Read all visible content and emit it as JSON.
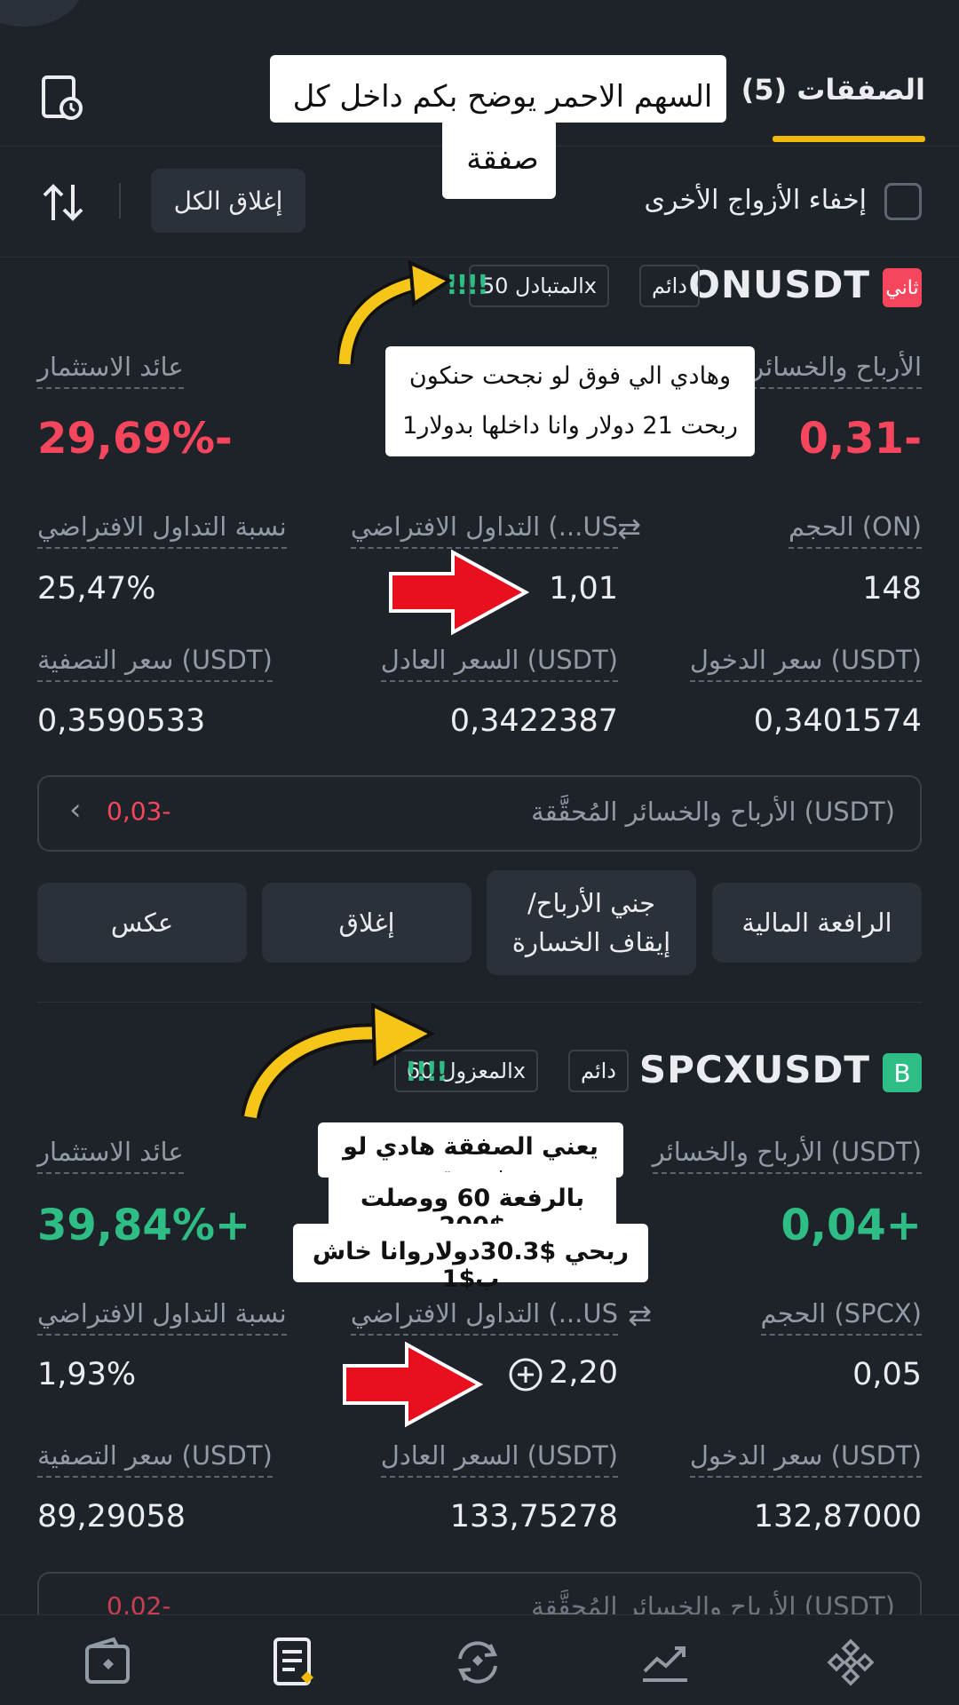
{
  "header": {
    "tab_label": "الصفقات (5)",
    "history_icon": "history-icon"
  },
  "annotation_top": "السهم الاحمر يوضح بكم داخل كل صفقة",
  "toolbar": {
    "hide_pairs_label": "إخفاء الأزواج الأخرى",
    "close_all_label": "إغلاق الكل",
    "sort_icon": "sort-arrows-icon"
  },
  "positions": [
    {
      "symbol": "ONUSDT",
      "side_badge": "ثاني",
      "type_tag": "دائم",
      "margin_tag": "المتبادل 50x",
      "bars": "!!!!",
      "note": "وهادي الي فوق لو نجحت حنكون ربحت 21 دولار وانا داخلها بدولار1",
      "pnl_label": "الأرباح والخسائر",
      "pnl_value": "0,31-",
      "roi_label": "عائد الاستثمار",
      "roi_value": "29,69%-",
      "size_label": "الحجم (ON)",
      "size_value": "148",
      "margin_label": "التداول الافتراضي (...US",
      "margin_value": "1,01",
      "margin_ratio_label": "نسبة التداول الافتراضي",
      "margin_ratio_value": "25,47%",
      "entry_label": "سعر الدخول (USDT)",
      "entry_value": "0,3401574",
      "mark_label": "السعر العادل (USDT)",
      "mark_value": "0,3422387",
      "liq_label": "سعر التصفية (USDT)",
      "liq_value": "0,3590533",
      "realized_label": "الأرباح والخسائر المُحقَّقة (USDT)",
      "realized_value": "0,03-",
      "buttons": [
        "الرافعة المالية",
        "جني الأرباح/ إيقاف الخسارة",
        "إغلاق",
        "عكس"
      ]
    },
    {
      "symbol": "SPCXUSDT",
      "side_badge": "B",
      "type_tag": "دائم",
      "margin_tag": "المعزول 60x",
      "bars": "!!!!",
      "note": [
        "يعني الصفقة هادي لو نجحت",
        "بالرفعة 60 ووصلت $200",
        "ربحي $30.3دولاروانا خاش ب$1"
      ],
      "pnl_label": "الأرباح والخسائر (USDT)",
      "pnl_value": "0,04+",
      "roi_label": "عائد الاستثمار",
      "roi_value": "39,84%+",
      "size_label": "الحجم (SPCX)",
      "size_value": "0,05",
      "margin_label": "التداول الافتراضي (...US",
      "margin_value": "2,20",
      "margin_ratio_label": "نسبة التداول الافتراضي",
      "margin_ratio_value": "1,93%",
      "entry_label": "سعر الدخول (USDT)",
      "entry_value": "132,87000",
      "mark_label": "السعر العادل (USDT)",
      "mark_value": "133,75278",
      "liq_label": "سعر التصفية (USDT)",
      "liq_value": "89,29058",
      "realized_label": "الأرباح والخسائر المُحقَّقة (USDT)",
      "realized_value": "0,02-"
    }
  ],
  "bottom_nav": [
    "wallet-icon",
    "orders-icon",
    "convert-icon",
    "chart-icon",
    "binance-icon"
  ],
  "colors": {
    "background": "#1e2329",
    "red": "#f6465d",
    "green": "#2ebd85",
    "accent": "#f0b90b"
  }
}
